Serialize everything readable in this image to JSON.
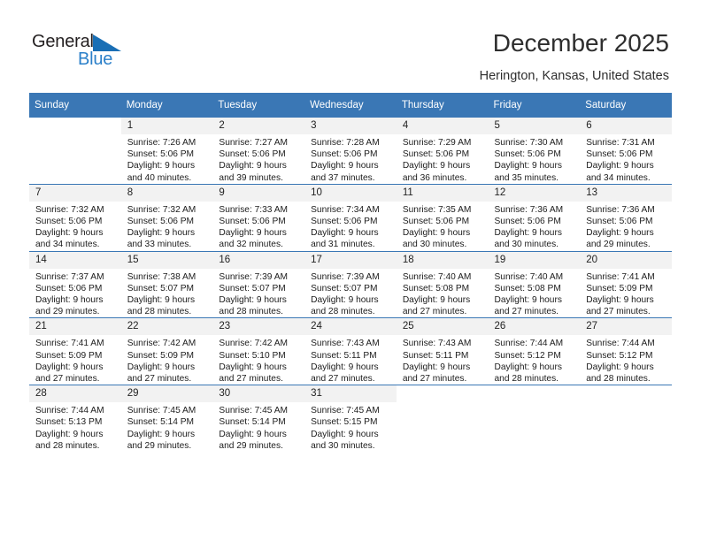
{
  "brand": {
    "name_part1": "General",
    "name_part2": "Blue",
    "accent_color": "#2a7fc9",
    "triangle_color": "#1a6fb5"
  },
  "header": {
    "title": "December 2025",
    "location": "Herington, Kansas, United States",
    "header_bg": "#3a77b5"
  },
  "weekdays": [
    "Sunday",
    "Monday",
    "Tuesday",
    "Wednesday",
    "Thursday",
    "Friday",
    "Saturday"
  ],
  "weeks": [
    [
      {
        "day": "",
        "sunrise": "",
        "sunset": "",
        "daylight1": "",
        "daylight2": ""
      },
      {
        "day": "1",
        "sunrise": "Sunrise: 7:26 AM",
        "sunset": "Sunset: 5:06 PM",
        "daylight1": "Daylight: 9 hours",
        "daylight2": "and 40 minutes."
      },
      {
        "day": "2",
        "sunrise": "Sunrise: 7:27 AM",
        "sunset": "Sunset: 5:06 PM",
        "daylight1": "Daylight: 9 hours",
        "daylight2": "and 39 minutes."
      },
      {
        "day": "3",
        "sunrise": "Sunrise: 7:28 AM",
        "sunset": "Sunset: 5:06 PM",
        "daylight1": "Daylight: 9 hours",
        "daylight2": "and 37 minutes."
      },
      {
        "day": "4",
        "sunrise": "Sunrise: 7:29 AM",
        "sunset": "Sunset: 5:06 PM",
        "daylight1": "Daylight: 9 hours",
        "daylight2": "and 36 minutes."
      },
      {
        "day": "5",
        "sunrise": "Sunrise: 7:30 AM",
        "sunset": "Sunset: 5:06 PM",
        "daylight1": "Daylight: 9 hours",
        "daylight2": "and 35 minutes."
      },
      {
        "day": "6",
        "sunrise": "Sunrise: 7:31 AM",
        "sunset": "Sunset: 5:06 PM",
        "daylight1": "Daylight: 9 hours",
        "daylight2": "and 34 minutes."
      }
    ],
    [
      {
        "day": "7",
        "sunrise": "Sunrise: 7:32 AM",
        "sunset": "Sunset: 5:06 PM",
        "daylight1": "Daylight: 9 hours",
        "daylight2": "and 34 minutes."
      },
      {
        "day": "8",
        "sunrise": "Sunrise: 7:32 AM",
        "sunset": "Sunset: 5:06 PM",
        "daylight1": "Daylight: 9 hours",
        "daylight2": "and 33 minutes."
      },
      {
        "day": "9",
        "sunrise": "Sunrise: 7:33 AM",
        "sunset": "Sunset: 5:06 PM",
        "daylight1": "Daylight: 9 hours",
        "daylight2": "and 32 minutes."
      },
      {
        "day": "10",
        "sunrise": "Sunrise: 7:34 AM",
        "sunset": "Sunset: 5:06 PM",
        "daylight1": "Daylight: 9 hours",
        "daylight2": "and 31 minutes."
      },
      {
        "day": "11",
        "sunrise": "Sunrise: 7:35 AM",
        "sunset": "Sunset: 5:06 PM",
        "daylight1": "Daylight: 9 hours",
        "daylight2": "and 30 minutes."
      },
      {
        "day": "12",
        "sunrise": "Sunrise: 7:36 AM",
        "sunset": "Sunset: 5:06 PM",
        "daylight1": "Daylight: 9 hours",
        "daylight2": "and 30 minutes."
      },
      {
        "day": "13",
        "sunrise": "Sunrise: 7:36 AM",
        "sunset": "Sunset: 5:06 PM",
        "daylight1": "Daylight: 9 hours",
        "daylight2": "and 29 minutes."
      }
    ],
    [
      {
        "day": "14",
        "sunrise": "Sunrise: 7:37 AM",
        "sunset": "Sunset: 5:06 PM",
        "daylight1": "Daylight: 9 hours",
        "daylight2": "and 29 minutes."
      },
      {
        "day": "15",
        "sunrise": "Sunrise: 7:38 AM",
        "sunset": "Sunset: 5:07 PM",
        "daylight1": "Daylight: 9 hours",
        "daylight2": "and 28 minutes."
      },
      {
        "day": "16",
        "sunrise": "Sunrise: 7:39 AM",
        "sunset": "Sunset: 5:07 PM",
        "daylight1": "Daylight: 9 hours",
        "daylight2": "and 28 minutes."
      },
      {
        "day": "17",
        "sunrise": "Sunrise: 7:39 AM",
        "sunset": "Sunset: 5:07 PM",
        "daylight1": "Daylight: 9 hours",
        "daylight2": "and 28 minutes."
      },
      {
        "day": "18",
        "sunrise": "Sunrise: 7:40 AM",
        "sunset": "Sunset: 5:08 PM",
        "daylight1": "Daylight: 9 hours",
        "daylight2": "and 27 minutes."
      },
      {
        "day": "19",
        "sunrise": "Sunrise: 7:40 AM",
        "sunset": "Sunset: 5:08 PM",
        "daylight1": "Daylight: 9 hours",
        "daylight2": "and 27 minutes."
      },
      {
        "day": "20",
        "sunrise": "Sunrise: 7:41 AM",
        "sunset": "Sunset: 5:09 PM",
        "daylight1": "Daylight: 9 hours",
        "daylight2": "and 27 minutes."
      }
    ],
    [
      {
        "day": "21",
        "sunrise": "Sunrise: 7:41 AM",
        "sunset": "Sunset: 5:09 PM",
        "daylight1": "Daylight: 9 hours",
        "daylight2": "and 27 minutes."
      },
      {
        "day": "22",
        "sunrise": "Sunrise: 7:42 AM",
        "sunset": "Sunset: 5:09 PM",
        "daylight1": "Daylight: 9 hours",
        "daylight2": "and 27 minutes."
      },
      {
        "day": "23",
        "sunrise": "Sunrise: 7:42 AM",
        "sunset": "Sunset: 5:10 PM",
        "daylight1": "Daylight: 9 hours",
        "daylight2": "and 27 minutes."
      },
      {
        "day": "24",
        "sunrise": "Sunrise: 7:43 AM",
        "sunset": "Sunset: 5:11 PM",
        "daylight1": "Daylight: 9 hours",
        "daylight2": "and 27 minutes."
      },
      {
        "day": "25",
        "sunrise": "Sunrise: 7:43 AM",
        "sunset": "Sunset: 5:11 PM",
        "daylight1": "Daylight: 9 hours",
        "daylight2": "and 27 minutes."
      },
      {
        "day": "26",
        "sunrise": "Sunrise: 7:44 AM",
        "sunset": "Sunset: 5:12 PM",
        "daylight1": "Daylight: 9 hours",
        "daylight2": "and 28 minutes."
      },
      {
        "day": "27",
        "sunrise": "Sunrise: 7:44 AM",
        "sunset": "Sunset: 5:12 PM",
        "daylight1": "Daylight: 9 hours",
        "daylight2": "and 28 minutes."
      }
    ],
    [
      {
        "day": "28",
        "sunrise": "Sunrise: 7:44 AM",
        "sunset": "Sunset: 5:13 PM",
        "daylight1": "Daylight: 9 hours",
        "daylight2": "and 28 minutes."
      },
      {
        "day": "29",
        "sunrise": "Sunrise: 7:45 AM",
        "sunset": "Sunset: 5:14 PM",
        "daylight1": "Daylight: 9 hours",
        "daylight2": "and 29 minutes."
      },
      {
        "day": "30",
        "sunrise": "Sunrise: 7:45 AM",
        "sunset": "Sunset: 5:14 PM",
        "daylight1": "Daylight: 9 hours",
        "daylight2": "and 29 minutes."
      },
      {
        "day": "31",
        "sunrise": "Sunrise: 7:45 AM",
        "sunset": "Sunset: 5:15 PM",
        "daylight1": "Daylight: 9 hours",
        "daylight2": "and 30 minutes."
      },
      {
        "day": "",
        "sunrise": "",
        "sunset": "",
        "daylight1": "",
        "daylight2": ""
      },
      {
        "day": "",
        "sunrise": "",
        "sunset": "",
        "daylight1": "",
        "daylight2": ""
      },
      {
        "day": "",
        "sunrise": "",
        "sunset": "",
        "daylight1": "",
        "daylight2": ""
      }
    ]
  ]
}
